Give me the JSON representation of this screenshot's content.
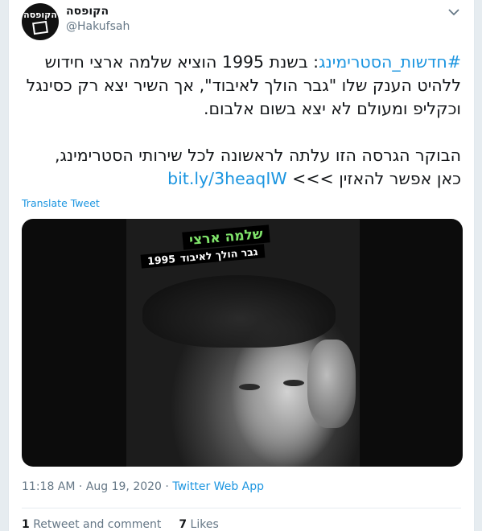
{
  "user": {
    "avatar_text": "הקופסה",
    "display_name": "הקופסה",
    "handle": "@Hakufsah"
  },
  "tweet": {
    "hashtag": "#חדשות_הסטרימינג",
    "line1_rest": ": בשנת 1995 הוציא שלמה ארצי חידוש",
    "line2": "ללהיט הענק שלו \"גבר הולך לאיבוד\", אך השיר יצא רק כסינגל",
    "line3": "וכקליפ ומעולם לא יצא בשום אלבום.",
    "line4": "הבוקר הגרסה הזו עלתה לראשונה לכל שירותי הסטרימינג,",
    "line5_text": "כאן אפשר להאזין >>>",
    "link": "bit.ly/3heaqIW",
    "translate": "Translate Tweet"
  },
  "media": {
    "artist_label": "שלמה ארצי",
    "song_label": "גבר הולך לאיבוד",
    "year_label": "1995"
  },
  "meta": {
    "time": "11:18 AM",
    "sep": " · ",
    "date": "Aug 19, 2020",
    "sep2": " · ",
    "source": "Twitter Web App"
  },
  "stats": {
    "retweets_count": "1",
    "retweets_label": "Retweet and comment",
    "likes_count": "7",
    "likes_label": "Likes"
  },
  "icons": {
    "caret": "chevron-down-icon"
  },
  "colors": {
    "link": "#1b95e0",
    "muted": "#657786",
    "artist_label": "#7fe36a"
  }
}
